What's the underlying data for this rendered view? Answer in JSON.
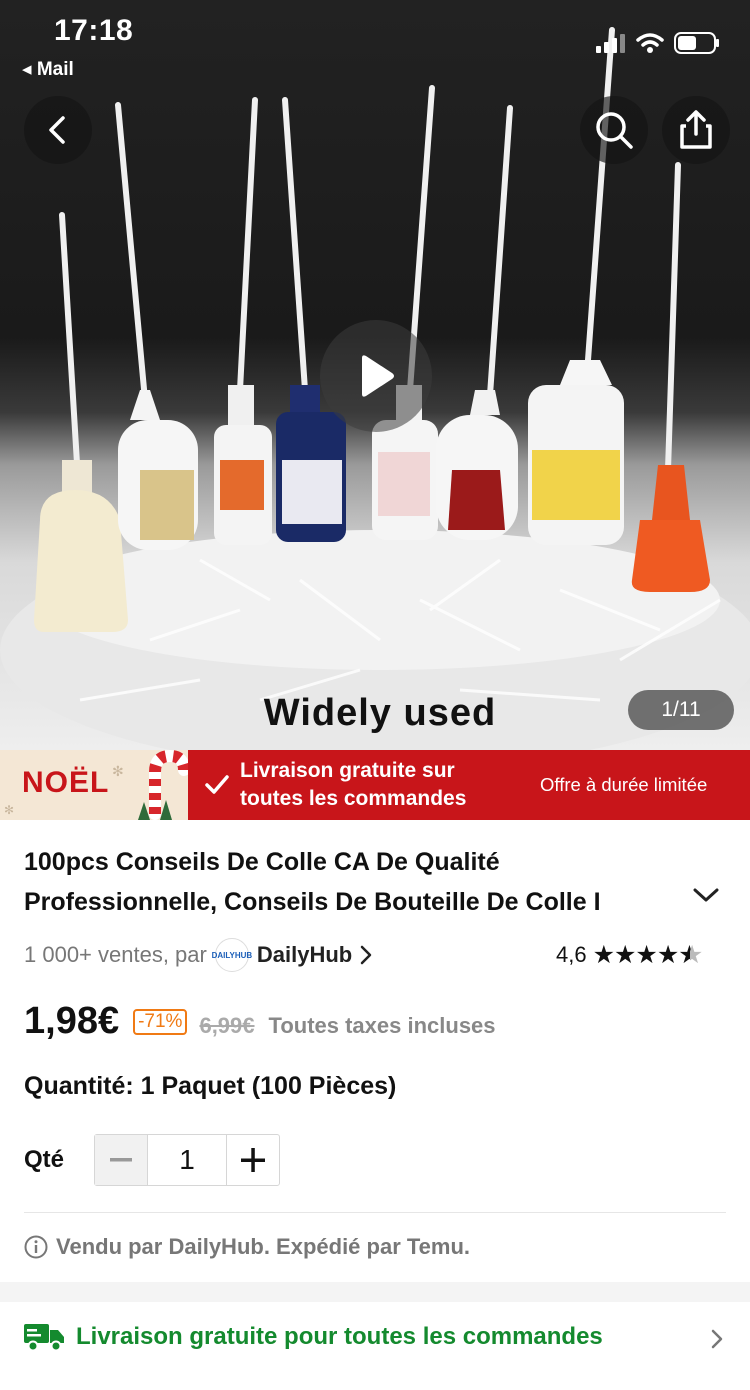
{
  "status_bar": {
    "time": "17:18",
    "back_app": "Mail"
  },
  "gallery": {
    "caption": "Widely used",
    "counter": "1/11"
  },
  "banner": {
    "badge": "NOËL",
    "free_shipping_line1": "Livraison gratuite sur",
    "free_shipping_line2": "toutes les commandes",
    "offer": "Offre à durée limitée"
  },
  "product": {
    "title_line1": "100pcs Conseils De Colle CA De Qualité",
    "title_line2": "Professionnelle, Conseils De Bouteille De Colle I",
    "sales": "1 000+ ventes, par",
    "store_logo_text": "DAILYHUB",
    "store": "DailyHub",
    "rating": "4,6",
    "rating_value": 4.6,
    "price": "1,98€",
    "discount": "-71%",
    "old_price": "6,99€",
    "tax_note": "Toutes taxes incluses",
    "quantity_option": "Quantité: 1 Paquet (100 Pièces)",
    "qty_label": "Qté",
    "qty_value": "1",
    "seller_note": "Vendu par DailyHub. Expédié par Temu."
  },
  "shipping": {
    "label": "Livraison gratuite pour toutes les commandes"
  },
  "icons": {
    "back": "chevron-left-icon",
    "search": "search-icon",
    "share": "share-icon",
    "play": "play-icon",
    "check": "check-icon",
    "expand": "chevron-down-icon",
    "info": "info-icon",
    "truck": "truck-icon",
    "chevron_right": "chevron-right-icon"
  },
  "colors": {
    "accent_red": "#c8151a",
    "discount_orange": "#f07a14",
    "shipping_green": "#148a2e"
  }
}
